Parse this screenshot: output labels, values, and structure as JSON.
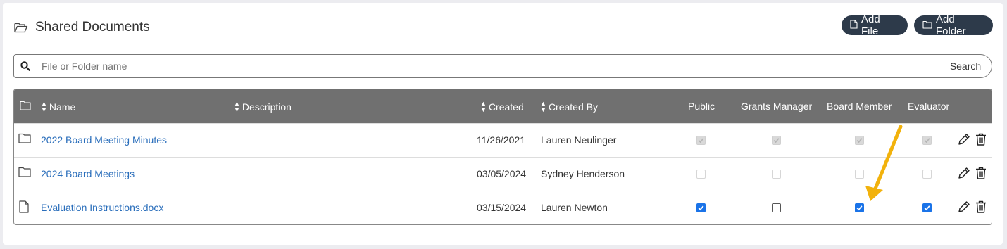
{
  "header": {
    "title": "Shared Documents",
    "add_file_label": "Add File",
    "add_folder_label": "Add Folder"
  },
  "search": {
    "placeholder": "File or Folder name",
    "button_label": "Search"
  },
  "table": {
    "columns": [
      "Name",
      "Description",
      "Created",
      "Created By",
      "Public",
      "Grants Manager",
      "Board Member",
      "Evaluator"
    ],
    "rows": [
      {
        "type": "folder",
        "name": "2022 Board Meeting Minutes",
        "description": "",
        "created": "11/26/2021",
        "created_by": "Lauren Neulinger",
        "public": true,
        "grants_manager": true,
        "board_member": true,
        "evaluator": true,
        "permissions_disabled": true
      },
      {
        "type": "folder",
        "name": "2024 Board Meetings",
        "description": "",
        "created": "03/05/2024",
        "created_by": "Sydney Henderson",
        "public": false,
        "grants_manager": false,
        "board_member": false,
        "evaluator": false,
        "permissions_disabled": true
      },
      {
        "type": "file",
        "name": "Evaluation Instructions.docx",
        "description": "",
        "created": "03/15/2024",
        "created_by": "Lauren Newton",
        "public": true,
        "grants_manager": false,
        "board_member": true,
        "evaluator": true,
        "permissions_disabled": false
      }
    ]
  },
  "colors": {
    "header_bg": "#707070",
    "pill_bg": "#2d3a4a",
    "link": "#2a6ebb",
    "checkbox_checked": "#1a73e8",
    "annotation_arrow": "#f2b20c"
  },
  "icons": [
    "folder-open-icon",
    "file-icon",
    "folder-icon",
    "search-icon",
    "sort-icon",
    "pencil-icon",
    "trash-icon"
  ]
}
